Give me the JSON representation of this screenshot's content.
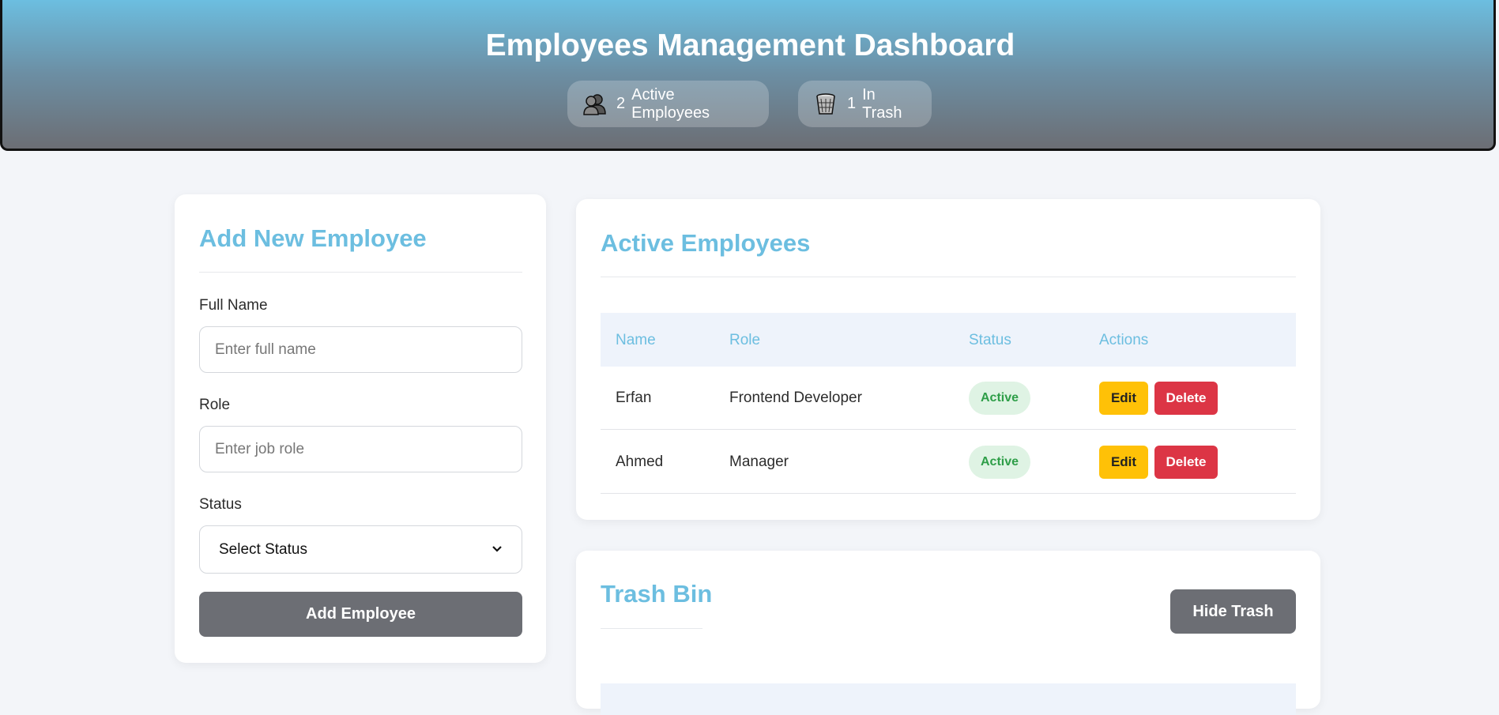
{
  "header": {
    "title": "Employees Management Dashboard",
    "stats": [
      {
        "icon": "people-icon",
        "count": "2",
        "label": "Active Employees"
      },
      {
        "icon": "trash-icon",
        "count": "1",
        "label": "In Trash"
      }
    ]
  },
  "form": {
    "title": "Add New Employee",
    "name_label": "Full Name",
    "name_placeholder": "Enter full name",
    "role_label": "Role",
    "role_placeholder": "Enter job role",
    "status_label": "Status",
    "status_selected": "Select Status",
    "submit_label": "Add Employee"
  },
  "employees": {
    "title": "Active Employees",
    "columns": [
      "Name",
      "Role",
      "Status",
      "Actions"
    ],
    "rows": [
      {
        "name": "Erfan",
        "role": "Frontend Developer",
        "status": "Active",
        "edit": "Edit",
        "delete": "Delete"
      },
      {
        "name": "Ahmed",
        "role": "Manager",
        "status": "Active",
        "edit": "Edit",
        "delete": "Delete"
      }
    ]
  },
  "trash": {
    "title": "Trash Bin",
    "toggle_label": "Hide Trash"
  },
  "colors": {
    "accent": "#6cbee0",
    "button_gray": "#6c6e74",
    "edit": "#ffc107",
    "delete": "#dc3545",
    "active_badge": "#2e9e48"
  }
}
